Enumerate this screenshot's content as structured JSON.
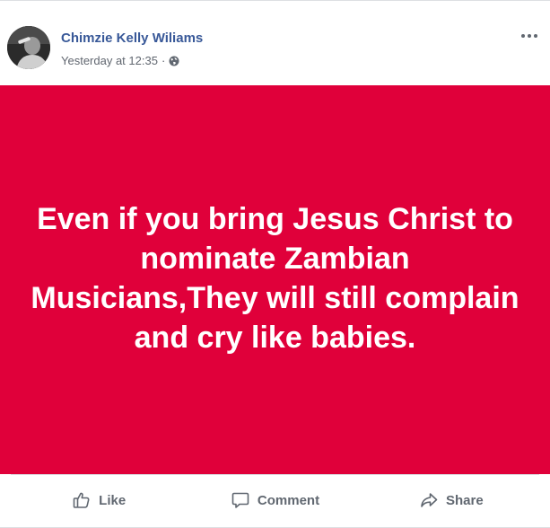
{
  "post": {
    "author": "Chimzie Kelly Wiliams",
    "timestamp": "Yesterday at 12:35",
    "separator": "·",
    "privacy_icon": "globe-icon",
    "more_icon": "more-options-icon",
    "text": "Even if you bring Jesus Christ to nominate Zambian Musicians,They will still complain and cry like babies.",
    "background_color": "#e0003a"
  },
  "actions": {
    "like_label": "Like",
    "comment_label": "Comment",
    "share_label": "Share"
  }
}
